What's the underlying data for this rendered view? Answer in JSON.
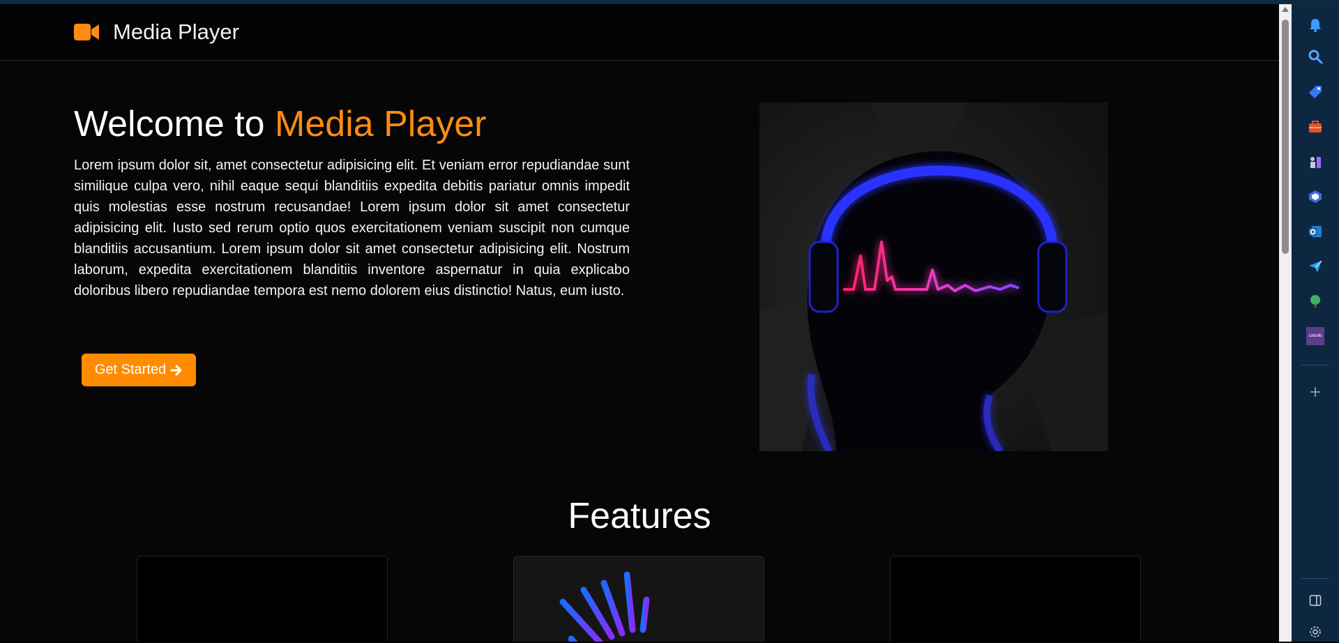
{
  "navbar": {
    "brand": "Media Player",
    "brand_icon": "video-camera-icon"
  },
  "hero": {
    "title_prefix": "Welcome to ",
    "title_accent": "Media Player",
    "paragraph": "Lorem ipsum dolor sit, amet consectetur adipisicing elit. Et veniam error repudiandae sunt similique culpa vero, nihil eaque sequi blanditiis expedita debitis pariatur omnis impedit quis molestias esse nostrum recusandae! Lorem ipsum dolor sit amet consectetur adipisicing elit. Iusto sed rerum optio quos exercitationem veniam suscipit non cumque blanditiis accusantium. Lorem ipsum dolor sit amet consectetur adipisicing elit. Nostrum laborum, expedita exercitationem blanditiis inventore aspernatur in quia explicabo doloribus libero repudiandae tempora est nemo dolorem eius distinctio! Natus, eum iusto.",
    "cta_label": "Get Started",
    "cta_icon": "arrow-right-icon",
    "image": "headphones-silhouette-illustration"
  },
  "features": {
    "title": "Features"
  },
  "sidebar": {
    "icons": [
      "bell-icon",
      "search-icon",
      "tag-icon",
      "briefcase-icon",
      "chess-icon",
      "copilot-icon",
      "outlook-icon",
      "send-icon",
      "tree-icon",
      "colorlib-icon"
    ],
    "colorlib_text": "colorlib",
    "bottom_icons": [
      "add-icon",
      "sidebar-toggle-icon",
      "settings-icon"
    ]
  },
  "colors": {
    "accent": "#ff8c10",
    "background": "#060606",
    "sidebar": "#0d2741"
  }
}
